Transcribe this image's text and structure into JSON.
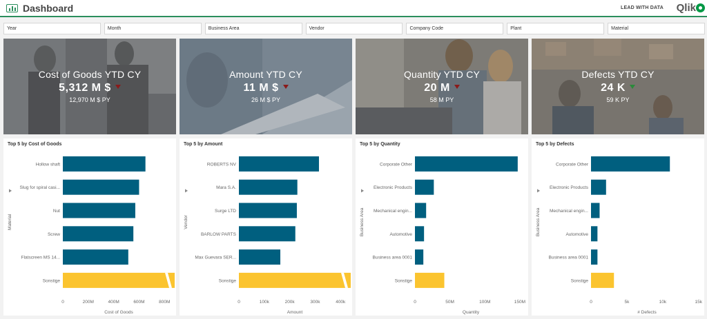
{
  "header": {
    "title": "Dashboard",
    "tagline": "LEAD WITH DATA",
    "brand": "Qlik",
    "accent": "#2a8e5c"
  },
  "filters": [
    "Year",
    "Month",
    "Business Area",
    "Vendor",
    "Company Code",
    "Plant",
    "Material"
  ],
  "kpis": [
    {
      "label": "Cost of Goods YTD CY",
      "value": "5,312 M $",
      "sub": "12,970 M $ PY",
      "trend": "down"
    },
    {
      "label": "Amount YTD CY",
      "value": "11 M $",
      "sub": "26 M $ PY",
      "trend": "down"
    },
    {
      "label": "Quantity YTD CY",
      "value": "20 M",
      "sub": "58 M PY",
      "trend": "down"
    },
    {
      "label": "Defects YTD CY",
      "value": "24 K",
      "sub": "59 K PY",
      "trend": "up"
    }
  ],
  "colors": {
    "bar": "#005f7f",
    "highlight": "#fbc42f",
    "trend_down": "#8b1a1a",
    "trend_up": "#2a8a3a"
  },
  "chart_data": [
    {
      "type": "bar",
      "title": "Top 5 by Cost of Goods",
      "xlabel": "Cost of Goods",
      "ylabel": "Material",
      "categories": [
        "Hollow shaft",
        "Slug for spiral casi...",
        "Nut",
        "Screw",
        "Flatscreen MS 14...",
        "Sonstige"
      ],
      "values": [
        650,
        600,
        570,
        555,
        515,
        1200
      ],
      "highlight_last": true,
      "ticks": [
        0,
        200,
        400,
        600,
        800
      ],
      "tick_labels": [
        "0",
        "200M",
        "400M",
        "600M",
        "800M"
      ],
      "xlim": [
        0,
        880
      ]
    },
    {
      "type": "bar",
      "title": "Top 5 by Amount",
      "xlabel": "Amount",
      "ylabel": "Vendor",
      "categories": [
        "ROBERTS NV",
        "Mara S.A.",
        "Surge LTD",
        "BARLOW PARTS",
        "Max Guevara SER...",
        "Sonstige"
      ],
      "values": [
        315,
        230,
        228,
        222,
        163,
        600
      ],
      "highlight_last": true,
      "ticks": [
        0,
        100,
        200,
        300,
        400
      ],
      "tick_labels": [
        "0",
        "100k",
        "200k",
        "300k",
        "400k"
      ],
      "xlim": [
        0,
        440
      ]
    },
    {
      "type": "bar",
      "title": "Top 5 by Quantity",
      "xlabel": "Quantity",
      "ylabel": "Business Area",
      "categories": [
        "Corporate Other",
        "Electronic Products",
        "Mechanical engin...",
        "Automotive",
        "Business area 0001",
        "Sonstige"
      ],
      "values": [
        147,
        27,
        16,
        13,
        12,
        42
      ],
      "highlight_last": false,
      "ticks": [
        0,
        50,
        100,
        150
      ],
      "tick_labels": [
        "0",
        "50M",
        "100M",
        "150M"
      ],
      "xlim": [
        0,
        160
      ]
    },
    {
      "type": "bar",
      "title": "Top 5 by Defects",
      "xlabel": "# Defects",
      "ylabel": "Business Area",
      "categories": [
        "Corporate Other",
        "Electronic Products",
        "Mechanical engin...",
        "Automotive",
        "Business area 0001",
        "Sonstige"
      ],
      "values": [
        11000,
        2100,
        1200,
        900,
        900,
        3200
      ],
      "highlight_last": false,
      "ticks": [
        0,
        5000,
        10000,
        15000
      ],
      "tick_labels": [
        "0",
        "5k",
        "10k",
        "15k"
      ],
      "xlim": [
        0,
        15600
      ]
    }
  ]
}
